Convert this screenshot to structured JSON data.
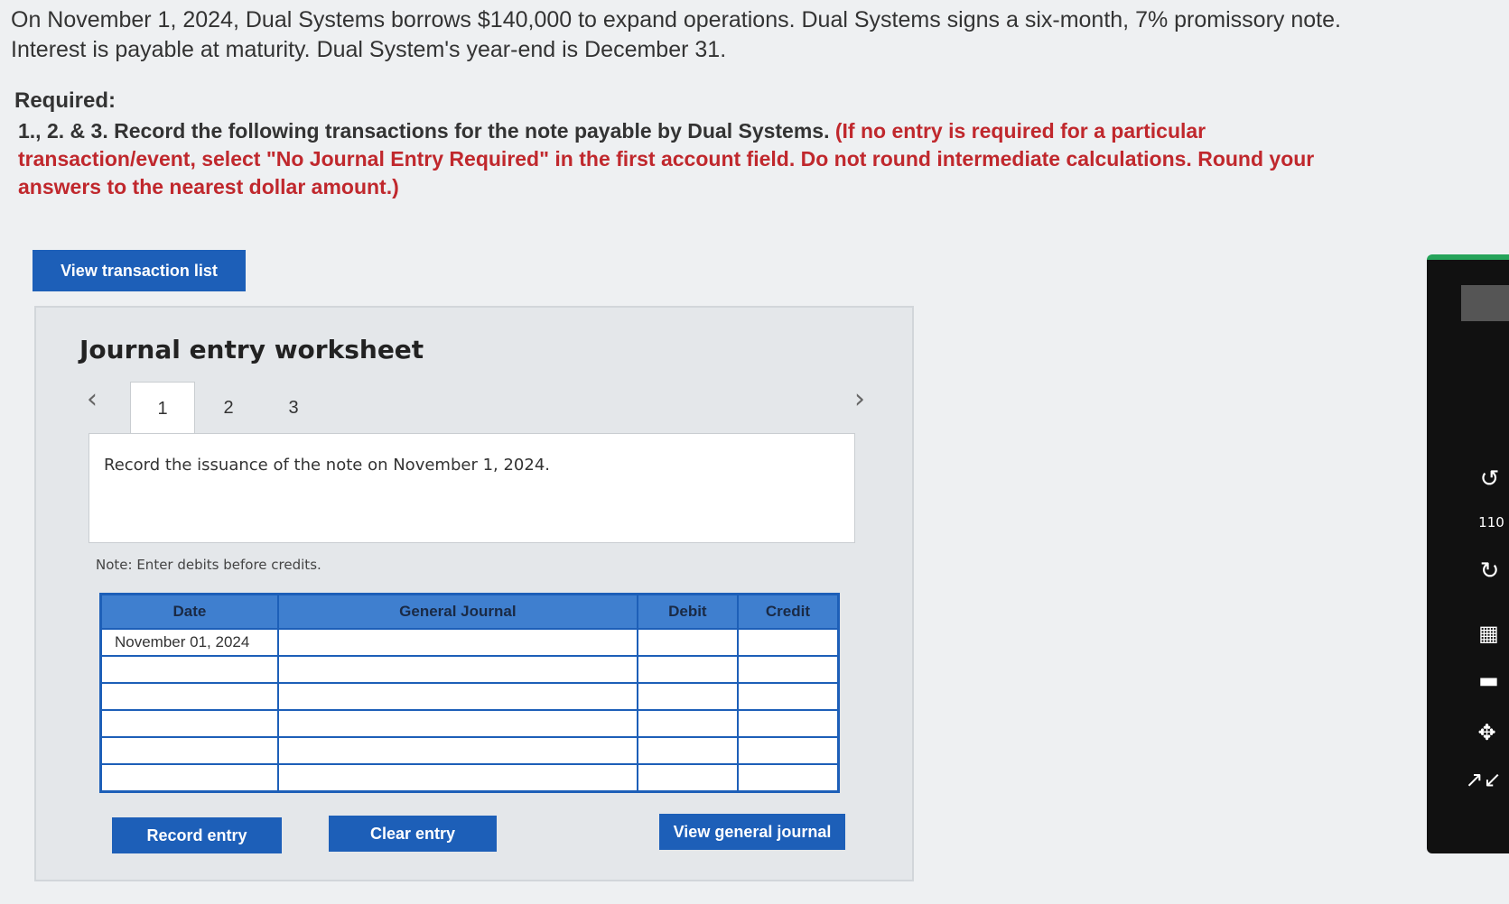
{
  "problem": {
    "line1": "On November 1, 2024, Dual Systems borrows $140,000 to expand operations. Dual Systems signs a six-month, 7% promissory note.",
    "line2": "Interest is payable at maturity. Dual System's year-end is December 31."
  },
  "required": {
    "title": "Required:",
    "prefix": "1., 2. & 3. Record the following transactions for the note payable by Dual Systems.",
    "note": " (If no entry is required for a particular transaction/event, select \"No Journal Entry Required\" in the first account field. Do not round intermediate calculations. Round your answers to the nearest dollar amount.)"
  },
  "buttons": {
    "view_transaction_list": "View transaction list",
    "record_entry": "Record entry",
    "clear_entry": "Clear entry",
    "view_general_journal": "View general journal"
  },
  "worksheet": {
    "title": "Journal entry worksheet",
    "tabs": [
      "1",
      "2",
      "3"
    ],
    "active_tab": "1",
    "description": "Record the issuance of the note on November 1, 2024.",
    "note": "Note: Enter debits before credits."
  },
  "table": {
    "headers": [
      "Date",
      "General Journal",
      "Debit",
      "Credit"
    ],
    "rows": [
      {
        "date": "November 01, 2024",
        "account": "",
        "debit": "",
        "credit": ""
      },
      {
        "date": "",
        "account": "",
        "debit": "",
        "credit": ""
      },
      {
        "date": "",
        "account": "",
        "debit": "",
        "credit": ""
      },
      {
        "date": "",
        "account": "",
        "debit": "",
        "credit": ""
      },
      {
        "date": "",
        "account": "",
        "debit": "",
        "credit": ""
      },
      {
        "date": "",
        "account": "",
        "debit": "",
        "credit": ""
      }
    ]
  },
  "side_toolbar": {
    "count_text": "110"
  }
}
